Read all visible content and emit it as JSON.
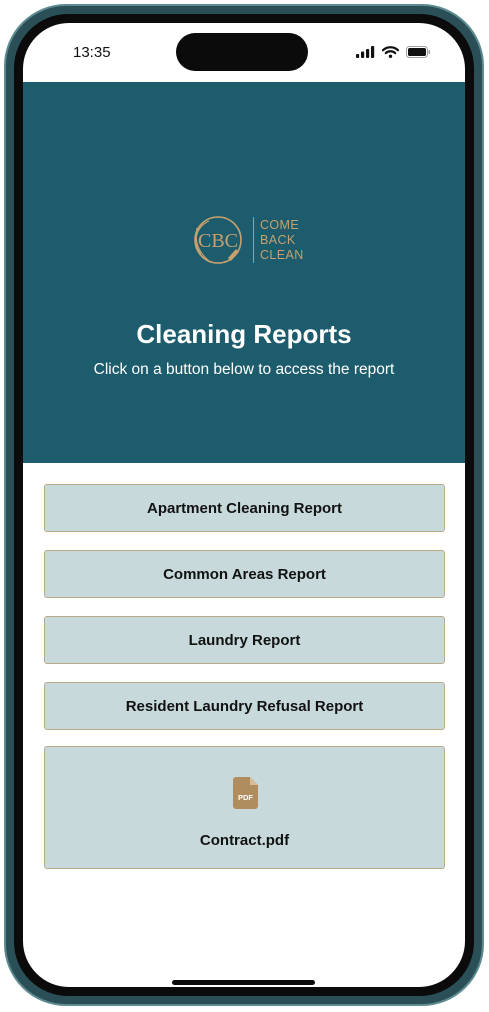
{
  "status_bar": {
    "time": "13:35",
    "icons": [
      "signal-icon",
      "wifi-icon",
      "battery-icon"
    ]
  },
  "header": {
    "logo": {
      "monogram": "CBC",
      "words": [
        "COME",
        "BACK",
        "CLEAN"
      ]
    },
    "title": "Cleaning Reports",
    "subtitle": "Click on a button below to access the report"
  },
  "reports": [
    {
      "label": "Apartment Cleaning Report"
    },
    {
      "label": "Common Areas Report"
    },
    {
      "label": "Laundry Report"
    },
    {
      "label": "Resident Laundry Refusal Report"
    }
  ],
  "attachment": {
    "icon": "pdf-file-icon",
    "icon_text": "PDF",
    "file_name": "Contract.pdf"
  },
  "colors": {
    "header_bg": "#1c5c6c",
    "button_bg": "#c7d9da",
    "button_border": "#b8ab88",
    "logo_gold": "#c7a06f",
    "phone_frame": "#2b4f57"
  }
}
